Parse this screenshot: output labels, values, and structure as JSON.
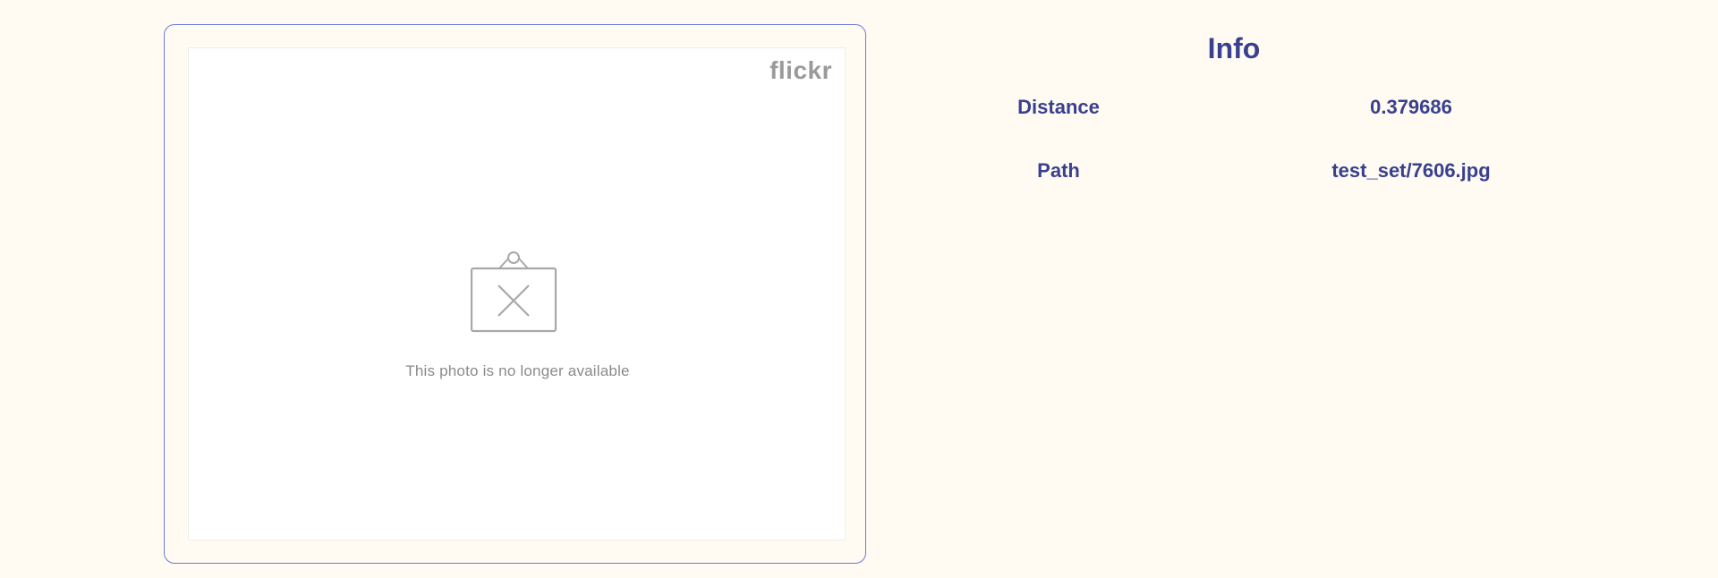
{
  "image_card": {
    "logo_text": "flickr",
    "unavailable_message": "This photo is no longer available",
    "icon": "broken-image-icon"
  },
  "info": {
    "title": "Info",
    "rows": [
      {
        "label": "Distance",
        "value": "0.379686"
      },
      {
        "label": "Path",
        "value": "test_set/7606.jpg"
      }
    ]
  },
  "colors": {
    "background": "#fffbf2",
    "card_border": "#6b79dd",
    "text_accent": "#39408f",
    "placeholder_gray": "#9a9a9a"
  }
}
